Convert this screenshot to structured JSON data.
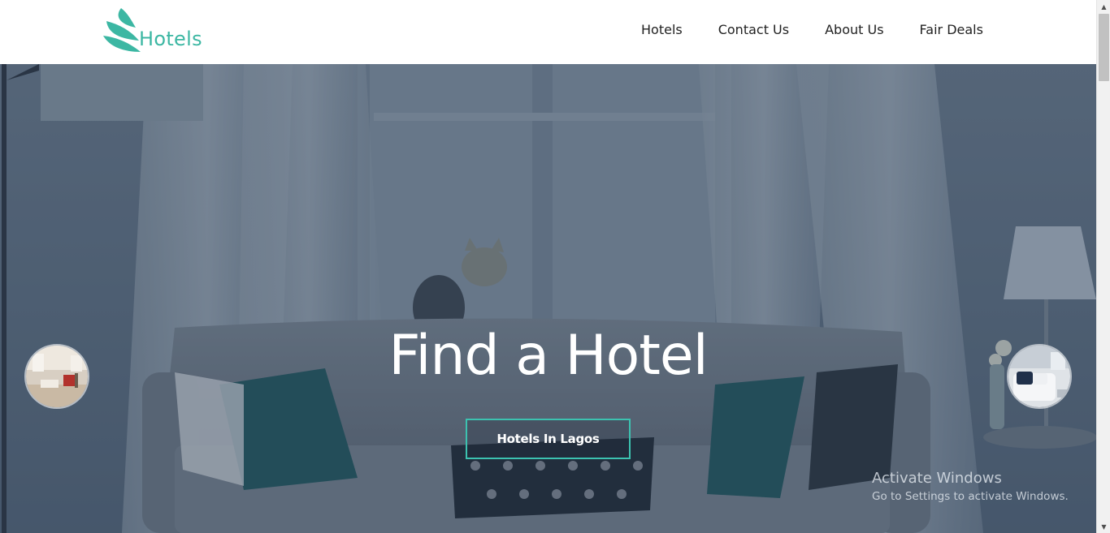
{
  "brand": {
    "logo_text": "Hotels",
    "accent_color": "#3cb7a3"
  },
  "nav": {
    "items": [
      {
        "label": "Hotels"
      },
      {
        "label": "Contact Us"
      },
      {
        "label": "About Us"
      },
      {
        "label": "Fair Deals"
      }
    ]
  },
  "hero": {
    "title": "Find a Hotel",
    "cta_label": "Hotels In Lagos",
    "cta_border_color": "#3cc2b0",
    "thumbnails": [
      {
        "icon": "room-photo-icon",
        "side": "left"
      },
      {
        "icon": "bedroom-photo-icon",
        "side": "right"
      }
    ]
  },
  "os_watermark": {
    "title": "Activate Windows",
    "subtitle": "Go to Settings to activate Windows."
  }
}
